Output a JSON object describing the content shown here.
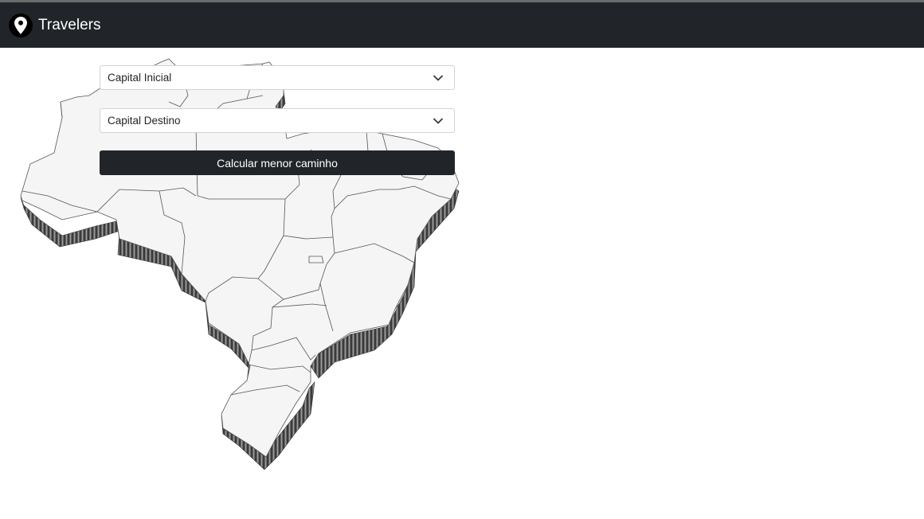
{
  "navbar": {
    "title": "Travelers",
    "icon": "map-pin-icon",
    "background": "#212529"
  },
  "form": {
    "origin_select": {
      "value": "Capital Inicial",
      "icon": "chevron-down-icon"
    },
    "destination_select": {
      "value": "Capital Destino",
      "icon": "chevron-down-icon"
    },
    "submit_button": {
      "label": "Calcular menor caminho",
      "background": "#212529"
    }
  },
  "map": {
    "subject": "Brazil 3D relief map with state borders",
    "fill": "#f5f5f5",
    "extrusion": "#555555"
  }
}
